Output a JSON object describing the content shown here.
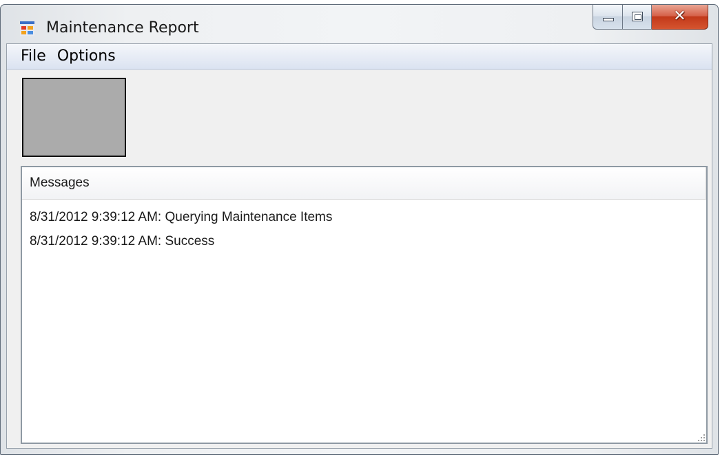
{
  "window": {
    "title": "Maintenance Report"
  },
  "menu": {
    "items": [
      {
        "label": "File"
      },
      {
        "label": "Options"
      }
    ]
  },
  "messages": {
    "column_header": "Messages",
    "rows": [
      {
        "text": "8/31/2012 9:39:12 AM: Querying Maintenance Items"
      },
      {
        "text": "8/31/2012 9:39:12 AM: Success"
      }
    ]
  },
  "icons": {
    "app": "app-form-icon",
    "minimize": "minimize-icon",
    "maximize": "maximize-icon",
    "close": "close-icon"
  },
  "colors": {
    "close_button": "#c2391a",
    "menubar": "#dbe3f1",
    "picture_box": "#ababab"
  }
}
